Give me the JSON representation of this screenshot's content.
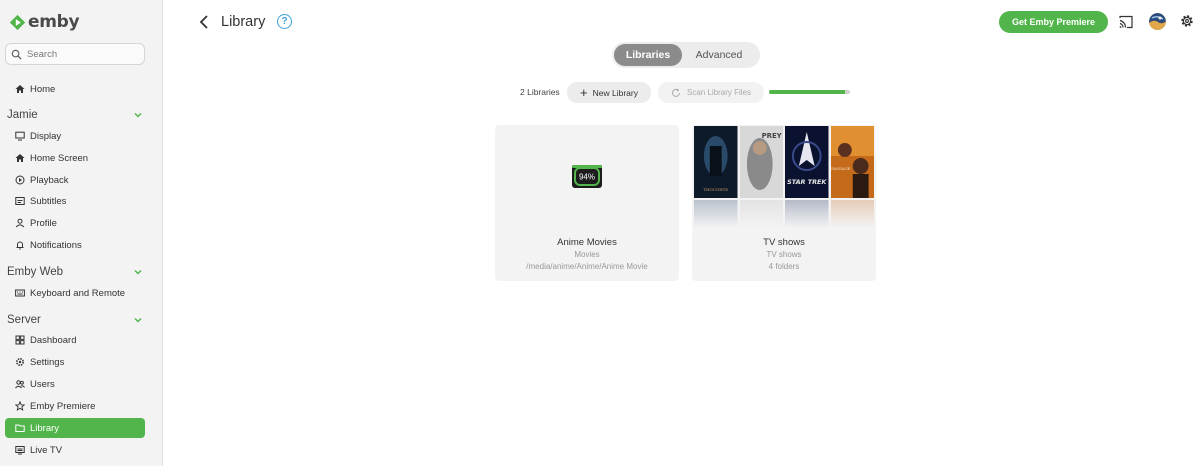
{
  "sidebar": {
    "logo_text": "emby",
    "search_placeholder": "Search",
    "home": {
      "label": "Home"
    },
    "sections": [
      {
        "title": "Jamie",
        "items": [
          "Display",
          "Home Screen",
          "Playback",
          "Subtitles",
          "Profile",
          "Notifications"
        ]
      },
      {
        "title": "Emby Web",
        "items": [
          "Keyboard and Remote"
        ]
      },
      {
        "title": "Server",
        "items": [
          "Dashboard",
          "Settings",
          "Users",
          "Emby Premiere",
          "Library",
          "Live TV"
        ]
      }
    ],
    "active_item": "Library"
  },
  "header": {
    "title": "Library",
    "help_glyph": "?",
    "premiere_button": "Get Emby Premiere"
  },
  "tabs": [
    {
      "label": "Libraries",
      "active": true
    },
    {
      "label": "Advanced",
      "active": false
    }
  ],
  "toolbar": {
    "library_count": "2 Libraries",
    "new_library": "New Library",
    "scan_library": "Scan Library Files",
    "scan_progress_fraction": 0.94
  },
  "libraries": [
    {
      "name": "Anime Movies",
      "type": "Movies",
      "detail": "/media/anime/Anime/Anime Movie",
      "scan_badge": "94%"
    },
    {
      "name": "TV shows",
      "type": "TV shows",
      "detail": "4 folders",
      "poster_labels": [
        "THOUGHTS",
        "PREY",
        "STAR TREK",
        "PASSAGE"
      ]
    }
  ],
  "colors": {
    "accent": "#52b54b",
    "help": "#3ea0dc",
    "tab_active": "#8b8b8b"
  },
  "icons": {
    "home": "home-icon",
    "display": "monitor-icon",
    "home_screen": "home-icon",
    "playback": "play-circle-icon",
    "subtitles": "subtitles-icon",
    "profile": "person-icon",
    "notifications": "bell-icon",
    "keyboard": "keyboard-icon",
    "dashboard": "dashboard-icon",
    "settings": "gear-icon",
    "users": "users-icon",
    "premiere": "star-icon",
    "library": "folder-icon",
    "live_tv": "tv-icon"
  }
}
